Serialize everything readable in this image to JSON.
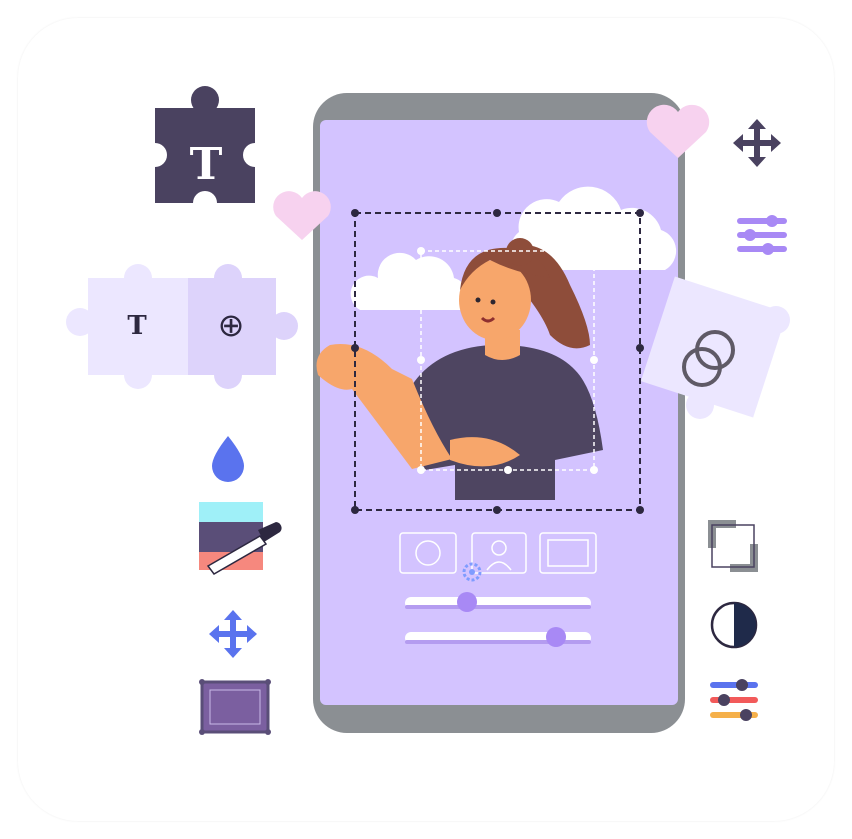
{
  "illustration": {
    "text_glyph": "T",
    "plus_glyph": "⊕",
    "icons": [
      "text-puzzle-icon",
      "heart-icon",
      "move-icon",
      "sliders-icon",
      "puzzle-icon",
      "rings-icon",
      "drop-icon",
      "color-picker-icon",
      "frame-icon",
      "crop-icon",
      "contrast-icon",
      "camera-icon",
      "portrait-icon",
      "gear-icon"
    ],
    "sliders": [
      {
        "name": "slider-top",
        "value": 0.32
      },
      {
        "name": "slider-bottom",
        "value": 0.83
      }
    ]
  },
  "colors": {
    "phone_frame": "#8b8f93",
    "screen": "#d3c3ff",
    "dark_navy": "#4a4260",
    "light_puzzle": "#ece7ff",
    "pink": "#f7d2ef",
    "blue": "#5a73ee",
    "lavender": "#a889f5",
    "skin": "#f7a66b",
    "hair": "#8e4d3a",
    "shirt": "#4e4561",
    "white": "#ffffff"
  }
}
